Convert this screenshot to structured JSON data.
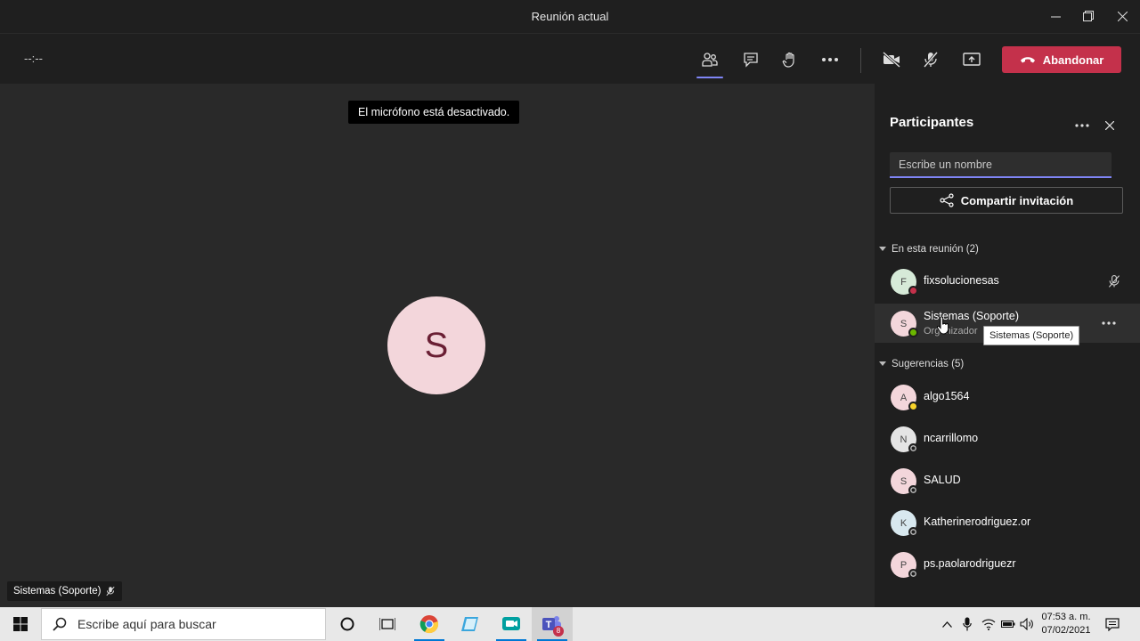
{
  "window": {
    "title": "Reunión actual"
  },
  "toolbar": {
    "timer": "--:--",
    "leave_label": "Abandonar"
  },
  "stage": {
    "toast": "El micrófono está desactivado.",
    "avatar_initial": "S",
    "name_badge": "Sistemas (Soporte)"
  },
  "panel": {
    "title": "Participantes",
    "search_placeholder": "Escribe un nombre",
    "share_label": "Compartir invitación",
    "in_meeting_header": "En esta reunión (2)",
    "in_meeting": [
      {
        "initial": "F",
        "name": "fixsolucionesas",
        "role": "",
        "status": "busy"
      },
      {
        "initial": "S",
        "name": "Sistemas (Soporte)",
        "role": "Organizador",
        "status": "available"
      }
    ],
    "suggestions_header": "Sugerencias (5)",
    "suggestions": [
      {
        "initial": "A",
        "name": "algo1564",
        "status": "away"
      },
      {
        "initial": "N",
        "name": "ncarrillomo",
        "status": "offline"
      },
      {
        "initial": "S",
        "name": "SALUD",
        "status": "offline"
      },
      {
        "initial": "K",
        "name": "Katherinerodriguez.or",
        "status": "offline"
      },
      {
        "initial": "P",
        "name": "ps.paolarodriguezr",
        "status": "offline"
      }
    ],
    "tooltip": "Sistemas (Soporte)"
  },
  "taskbar": {
    "search_placeholder": "Escribe aquí para buscar",
    "teams_badge": "8",
    "time": "07:53 a. m.",
    "date": "07/02/2021"
  },
  "colors": {
    "accent": "#7f85f5",
    "leave": "#c4314b",
    "busy": "#c4314b",
    "available": "#6bb700",
    "away": "#f8d22a"
  }
}
